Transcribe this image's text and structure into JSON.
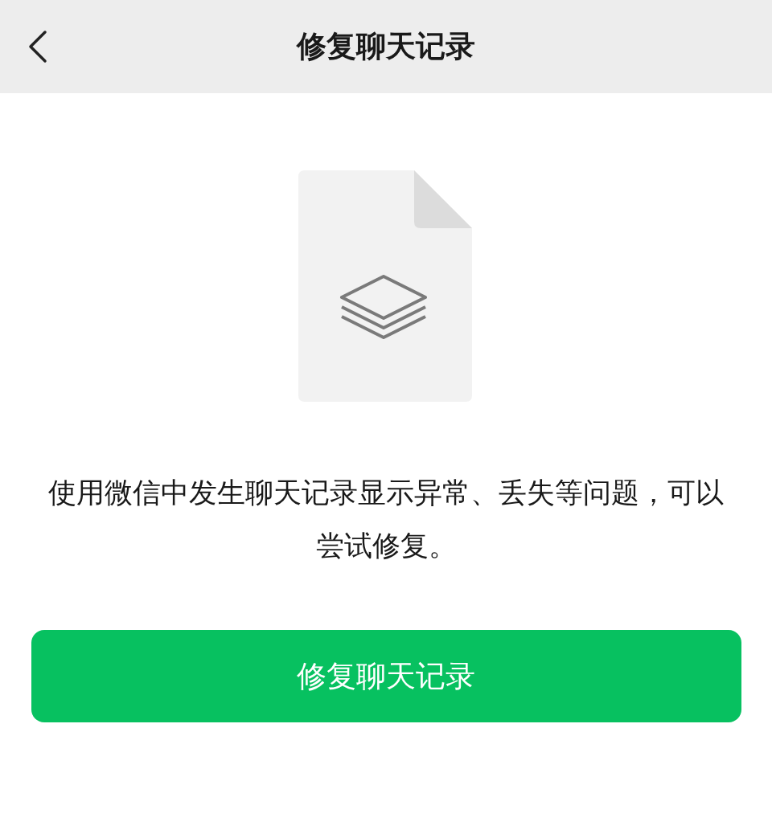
{
  "header": {
    "title": "修复聊天记录"
  },
  "description": "使用微信中发生聊天记录显示异常、丢失等问题，可以尝试修复。",
  "button": {
    "label": "修复聊天记录"
  }
}
